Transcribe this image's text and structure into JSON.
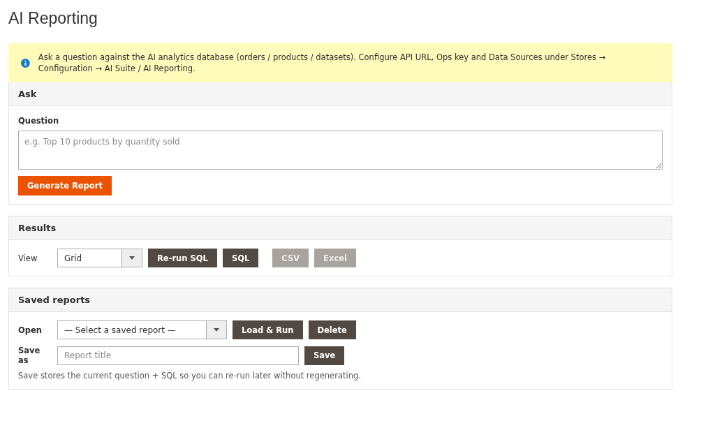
{
  "page": {
    "title": "AI Reporting"
  },
  "notice": {
    "text": "Ask a question against the AI analytics database (orders / products / datasets). Configure API URL, Ops key and Data Sources under Stores → Configuration → AI Suite / AI Reporting."
  },
  "ask": {
    "title": "Ask",
    "label": "Question",
    "placeholder": "e.g. Top 10 products by quantity sold",
    "button": "Generate Report"
  },
  "results": {
    "title": "Results",
    "label": "View",
    "select": "Grid",
    "buttons": [
      {
        "label": "Re-run SQL",
        "disabled": false
      },
      {
        "label": "SQL",
        "disabled": false
      },
      {
        "label": "CSV",
        "disabled": true
      },
      {
        "label": "Excel",
        "disabled": true
      }
    ]
  },
  "saved_reports": {
    "title": "Saved reports",
    "open_label": "Open",
    "select": "— Select a saved report —",
    "open_buttons": [
      {
        "label": "Load & Run",
        "disabled": false
      },
      {
        "label": "Delete",
        "disabled": false
      }
    ],
    "save_label": "Save as",
    "save_placeholder": "Report title",
    "save_button": "Save",
    "hint": "Save stores the current question + SQL so you can re-run later without regenerating."
  }
}
